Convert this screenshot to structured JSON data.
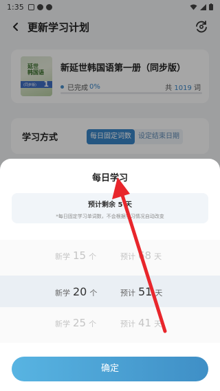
{
  "status_bar": {
    "time": "1:35"
  },
  "header": {
    "title": "更新学习计划",
    "back_icon": "back-arrow-icon",
    "action_icon": "refresh-settings-icon"
  },
  "book": {
    "title": "新延世韩国语第一册（同步版）",
    "cover_text_top": "延世",
    "cover_text_bottom": "韩国语",
    "cover_tag": "(同步版)",
    "cover_number": "1",
    "completed_label": "已完成",
    "completed_pct": "0%",
    "total_prefix": "共",
    "total_count": "1019",
    "total_unit": "词",
    "progress_fraction": 0
  },
  "study_mode": {
    "label": "学习方式",
    "options": [
      "每日固定词数",
      "设定结束日期"
    ],
    "active_index": 0
  },
  "sheet": {
    "title": "每日学习",
    "estimate_text": "预计剩余 5  天",
    "note": "*每日固定学习单词数，不会根据学习情况自动改变",
    "rows": [
      {
        "learn_label": "新学",
        "learn_value": "15",
        "learn_unit": "个",
        "est_label": "预计",
        "est_value": "68",
        "est_unit": "天"
      },
      {
        "learn_label": "新学",
        "learn_value": "20",
        "learn_unit": "个",
        "est_label": "预计",
        "est_value": "51",
        "est_unit": "天"
      },
      {
        "learn_label": "新学",
        "learn_value": "25",
        "learn_unit": "个",
        "est_label": "预计",
        "est_value": "41",
        "est_unit": "天"
      }
    ],
    "confirm_label": "确定"
  },
  "colors": {
    "accent": "#3a86c8",
    "arrow": "#e8262c"
  }
}
